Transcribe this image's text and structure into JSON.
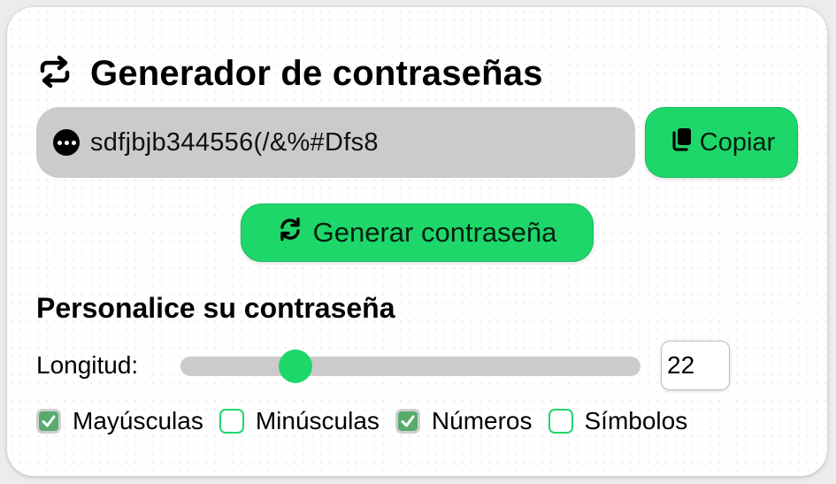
{
  "header": {
    "title": "Generador de contraseñas",
    "icon": "repeat-arrows-icon"
  },
  "password": {
    "value": "sdfjbjb344556(/&%#Dfs8",
    "icon": "more-dots-icon"
  },
  "actions": {
    "copy_label": "Copiar",
    "copy_icon": "copy-icon",
    "generate_label": "Generar contraseña",
    "generate_icon": "refresh-icon"
  },
  "customize": {
    "title": "Personalice su contraseña",
    "length_label": "Longitud:",
    "length_value": "22",
    "slider_fraction": 0.25,
    "options": [
      {
        "label": "Mayúsculas",
        "checked": true
      },
      {
        "label": "Minúsculas",
        "checked": false
      },
      {
        "label": "Números",
        "checked": true
      },
      {
        "label": "Símbolos",
        "checked": false
      }
    ]
  },
  "colors": {
    "accent": "#1ed76a",
    "field_bg": "#cdcaca",
    "checked_bg": "#58ab6d"
  }
}
